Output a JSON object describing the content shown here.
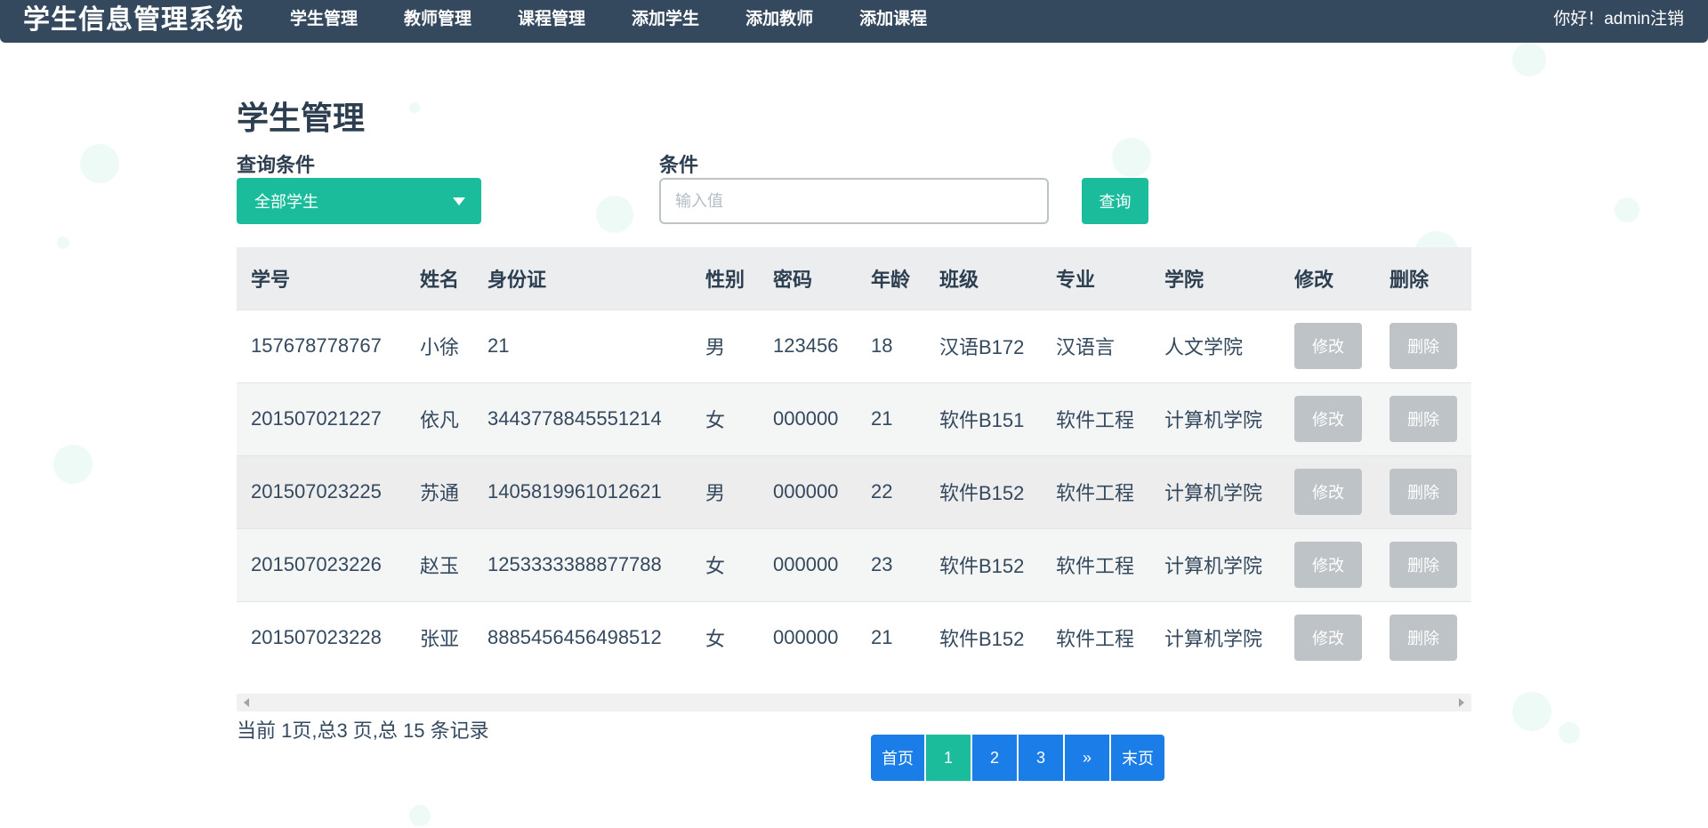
{
  "navbar": {
    "brand": "学生信息管理系统",
    "links": [
      "学生管理",
      "教师管理",
      "课程管理",
      "添加学生",
      "添加教师",
      "添加课程"
    ],
    "greeting": "你好！admin",
    "logout": "注销"
  },
  "page": {
    "title": "学生管理",
    "filter_label": "查询条件",
    "filter_value": "全部学生",
    "condition_label": "条件",
    "condition_placeholder": "输入值",
    "query_button": "查询"
  },
  "table": {
    "headers": [
      "学号",
      "姓名",
      "身份证",
      "性别",
      "密码",
      "年龄",
      "班级",
      "专业",
      "学院",
      "修改",
      "删除"
    ],
    "rows": [
      [
        "157678778767",
        "小徐",
        "21",
        "男",
        "123456",
        "18",
        "汉语B172",
        "汉语言",
        "人文学院"
      ],
      [
        "201507021227",
        "依凡",
        "3443778845551214",
        "女",
        "000000",
        "21",
        "软件B151",
        "软件工程",
        "计算机学院"
      ],
      [
        "201507023225",
        "苏通",
        "1405819961012621",
        "男",
        "000000",
        "22",
        "软件B152",
        "软件工程",
        "计算机学院"
      ],
      [
        "201507023226",
        "赵玉",
        "1253333388877788",
        "女",
        "000000",
        "23",
        "软件B152",
        "软件工程",
        "计算机学院"
      ],
      [
        "201507023228",
        "张亚",
        "8885456456498512",
        "女",
        "000000",
        "21",
        "软件B152",
        "软件工程",
        "计算机学院"
      ]
    ],
    "edit_label": "修改",
    "delete_label": "删除"
  },
  "footer": {
    "records_text": "当前 1页,总3 页,总 15 条记录",
    "pagination": {
      "first": "首页",
      "pages": [
        "1",
        "2",
        "3"
      ],
      "next": "»",
      "last": "末页",
      "current": "1"
    }
  },
  "colors": {
    "navbar": "#34495e",
    "accent": "#1abc9c",
    "pagination": "#1a7de8",
    "action_button": "#bdc3c7"
  }
}
